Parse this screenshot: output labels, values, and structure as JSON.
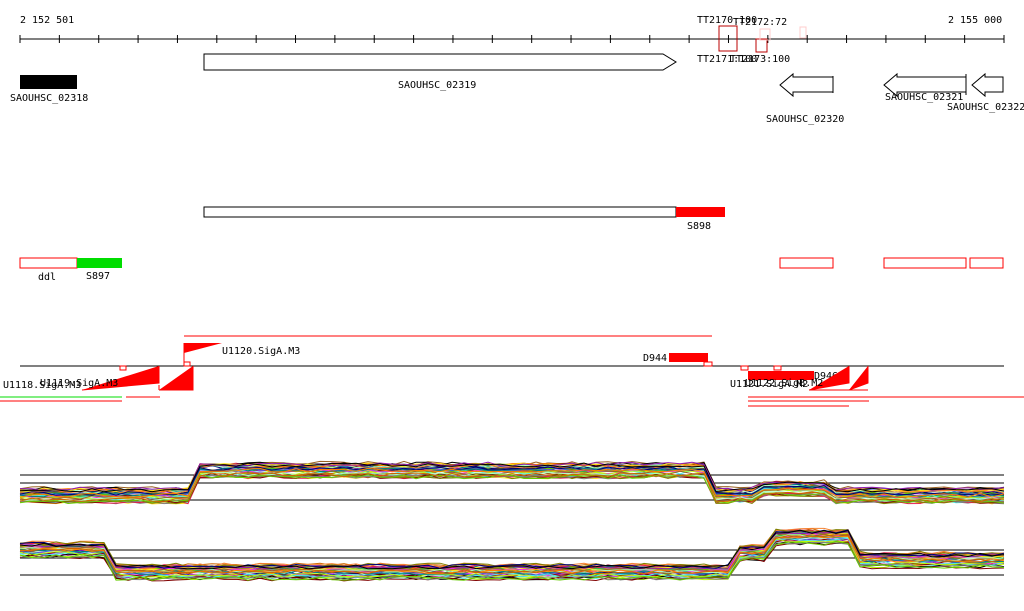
{
  "ruler": {
    "start_label": "2 152 501",
    "end_label": "2 155 000",
    "start": 2152501,
    "end": 2155000
  },
  "terminators": [
    {
      "label": "TT2170:100"
    },
    {
      "label": "TT2172:72"
    },
    {
      "label": "TT2171:100"
    },
    {
      "label": "TT2173:100"
    }
  ],
  "genes": [
    {
      "label": "SAOUHSC_02318"
    },
    {
      "label": "SAOUHSC_02319"
    },
    {
      "label": "SAOUHSC_02320"
    },
    {
      "label": "SAOUHSC_02321"
    },
    {
      "label": "SAOUHSC_02322"
    }
  ],
  "regions": {
    "s898": "S898",
    "ddl": "ddl",
    "s897": "S897"
  },
  "promoters": {
    "u1120": "U1120.SigA.M3",
    "d944": "D944",
    "left_overlap": "U1118.SigA.M3",
    "left_overlap2": "U1119.SigA.M3",
    "right_overlap": "U1121.SigA.M2",
    "right_overlap2": "U1122.SigB.M2",
    "d946": "D946"
  },
  "colors": {
    "feature": "#ff0000",
    "green": "#00dd00",
    "gene_fill": "#000000"
  }
}
